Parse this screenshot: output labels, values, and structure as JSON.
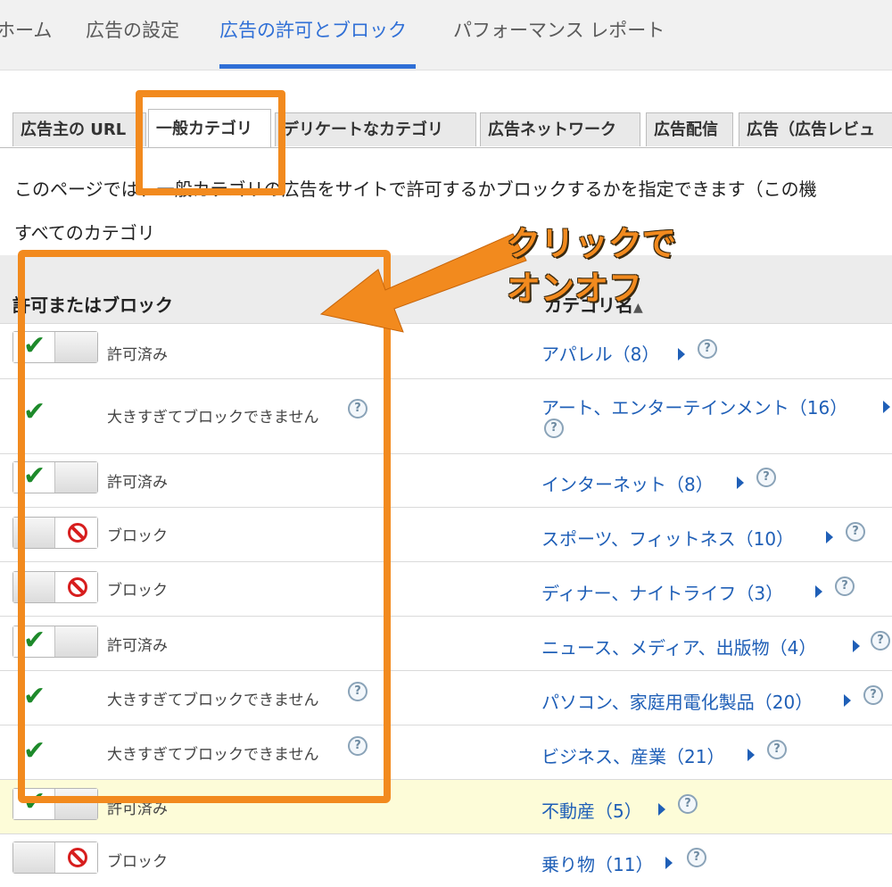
{
  "top_nav": {
    "items": [
      "ホーム",
      "広告の設定",
      "広告の許可とブロック",
      "パフォーマンス レポート"
    ],
    "active_index": 2
  },
  "sub_tabs": [
    "広告主の URL",
    "一般カテゴリ",
    "デリケートなカテゴリ",
    "広告ネットワーク",
    "広告配信",
    "広告（広告レビュ"
  ],
  "sub_tabs_active": 1,
  "description": "このページでは、一般カテゴリの広告をサイトで許可するかブロックするかを指定できます（この機",
  "all_categories_label": "すべてのカテゴリ",
  "table": {
    "col_allow_block": "許可またはブロック",
    "col_category": "カテゴリ名",
    "rows": [
      {
        "status": "許可済み",
        "category": "アパレル（8）",
        "state": "allowed"
      },
      {
        "status": "大きすぎてブロックできません",
        "category": "アート、エンターテインメント（16）",
        "state": "too_large"
      },
      {
        "status": "許可済み",
        "category": "インターネット（8）",
        "state": "allowed"
      },
      {
        "status": "ブロック",
        "category": "スポーツ、フィットネス（10）",
        "state": "blocked"
      },
      {
        "status": "ブロック",
        "category": "ディナー、ナイトライフ（3）",
        "state": "blocked"
      },
      {
        "status": "許可済み",
        "category": "ニュース、メディア、出版物（4）",
        "state": "allowed"
      },
      {
        "status": "大きすぎてブロックできません",
        "category": "パソコン、家庭用電化製品（20）",
        "state": "too_large"
      },
      {
        "status": "大きすぎてブロックできません",
        "category": "ビジネス、産業（21）",
        "state": "too_large"
      },
      {
        "status": "許可済み",
        "category": "不動産（5）",
        "state": "allowed"
      },
      {
        "status": "ブロック",
        "category": "乗り物（11）",
        "state": "blocked"
      }
    ]
  },
  "annotation": {
    "line1": "クリックで",
    "line2": "オンオフ",
    "color": "#f28a1e"
  },
  "icons": {
    "check": "check-icon",
    "block": "block-icon",
    "help": "help-icon",
    "expand": "expand-arrow-icon",
    "sort": "sort-arrow-icon"
  }
}
